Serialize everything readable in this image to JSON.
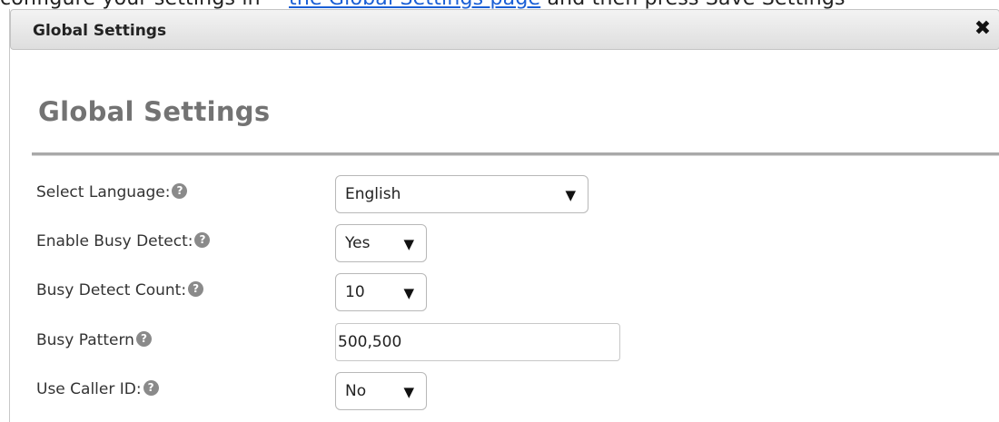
{
  "background_text": {
    "prefix": "configure your settings in",
    "link": "the Global Settings page",
    "suffix": "and then press Save Settings"
  },
  "dialog": {
    "title": "Global Settings",
    "close_icon": "close-x-icon"
  },
  "page": {
    "heading": "Global Settings"
  },
  "fields": {
    "language": {
      "label": "Select Language:",
      "value": "English"
    },
    "busy_detect": {
      "label": "Enable Busy Detect:",
      "value": "Yes"
    },
    "busy_count": {
      "label": "Busy Detect Count:",
      "value": "10"
    },
    "busy_pattern": {
      "label": "Busy Pattern",
      "value": "500,500"
    },
    "caller_id": {
      "label": "Use Caller ID:",
      "value": "No"
    }
  },
  "help_glyph": "?",
  "caret_glyph": "▼",
  "close_glyph": "✖"
}
